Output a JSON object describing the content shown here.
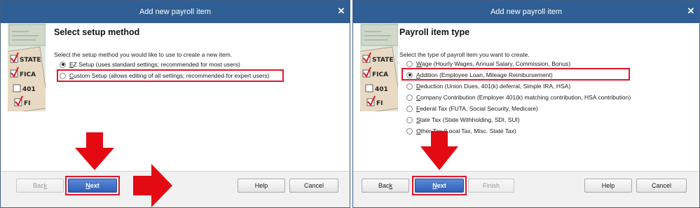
{
  "dialogs": [
    {
      "title": "Add new payroll item",
      "heading": "Select setup method",
      "prompt": "Select the setup method you would like to use to create a new item.",
      "options": [
        {
          "hotkey": "E",
          "rest": "Z Setup (uses standard settings; recommended for most users)",
          "checked": true
        },
        {
          "hotkey": "C",
          "rest": "ustom Setup (allows editing of all settings; recommended for expert users)",
          "checked": false
        }
      ],
      "buttons": {
        "back": {
          "pre": "Bac",
          "hotkey": "k",
          "post": ""
        },
        "next": {
          "pre": "",
          "hotkey": "N",
          "post": "ext"
        },
        "help": "Help",
        "cancel": "Cancel"
      }
    },
    {
      "title": "Add new payroll item",
      "heading": "Payroll item type",
      "prompt": "Select the type of payroll item you want to create.",
      "options": [
        {
          "hotkey": "W",
          "rest": "age (Hourly Wages, Annual Salary, Commission, Bonus)",
          "checked": false
        },
        {
          "hotkey": "A",
          "rest": "ddition (Employee Loan, Mileage Reimbursement)",
          "checked": true
        },
        {
          "hotkey": "D",
          "rest": "eduction (Union Dues, 401(k) deferral, Simple IRA, HSA)",
          "checked": false
        },
        {
          "hotkey": "C",
          "rest": "ompany Contribution (Employer 401(k) matching contribution, HSA contribution)",
          "checked": false
        },
        {
          "hotkey": "F",
          "rest": "ederal Tax (FUTA, Social Security, Medicare)",
          "checked": false
        },
        {
          "hotkey": "S",
          "rest": "tate Tax (State Withholding, SDI, SUI)",
          "checked": false
        },
        {
          "hotkey": "O",
          "rest": "ther Tax (Local Tax, Misc. State Tax)",
          "checked": false
        }
      ],
      "buttons": {
        "back": {
          "pre": "Bac",
          "hotkey": "k",
          "post": ""
        },
        "next": {
          "pre": "",
          "hotkey": "N",
          "post": "ext"
        },
        "finish": "Finish",
        "help": "Help",
        "cancel": "Cancel"
      }
    }
  ],
  "art_labels": [
    "STATE",
    "FICA",
    "401",
    "FI"
  ],
  "colors": {
    "titlebar": "#2f5f95",
    "highlight": "#e3162c",
    "primary_button": "#2f5fb7"
  }
}
